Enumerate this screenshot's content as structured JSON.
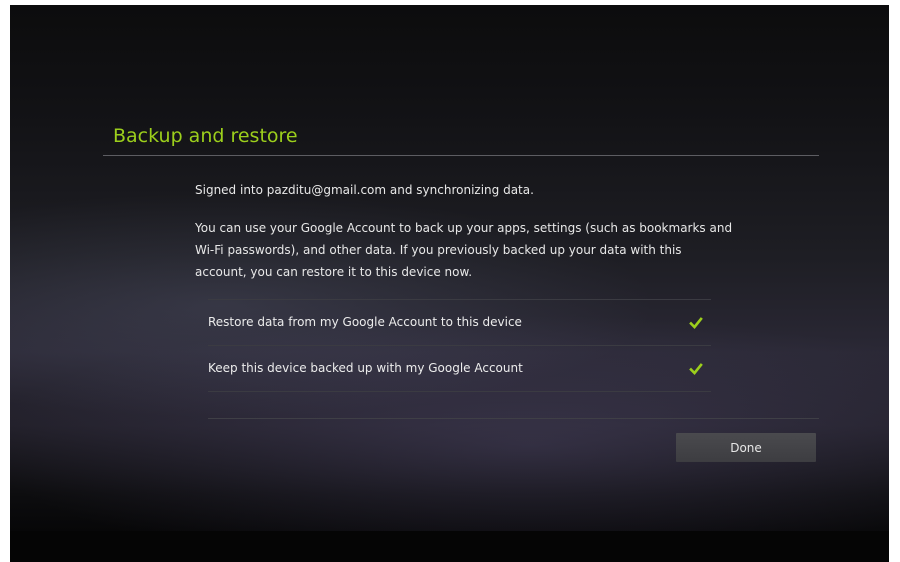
{
  "dialog": {
    "title": "Backup and restore",
    "status_text": "Signed into pazditu@gmail.com and synchronizing data.",
    "description": "You can use your Google Account to back up your apps, settings (such as bookmarks and Wi-Fi passwords), and other data. If you previously backed up your data with this account, you can restore it to this device now.",
    "options": [
      {
        "label": "Restore data from my Google Account to this device",
        "checked": true
      },
      {
        "label": "Keep this device backed up with my Google Account",
        "checked": true
      }
    ],
    "done_label": "Done"
  },
  "colors": {
    "title_accent": "#9ccf1c",
    "checkmark": "#9ccf1c",
    "button_bg": "#434347"
  }
}
